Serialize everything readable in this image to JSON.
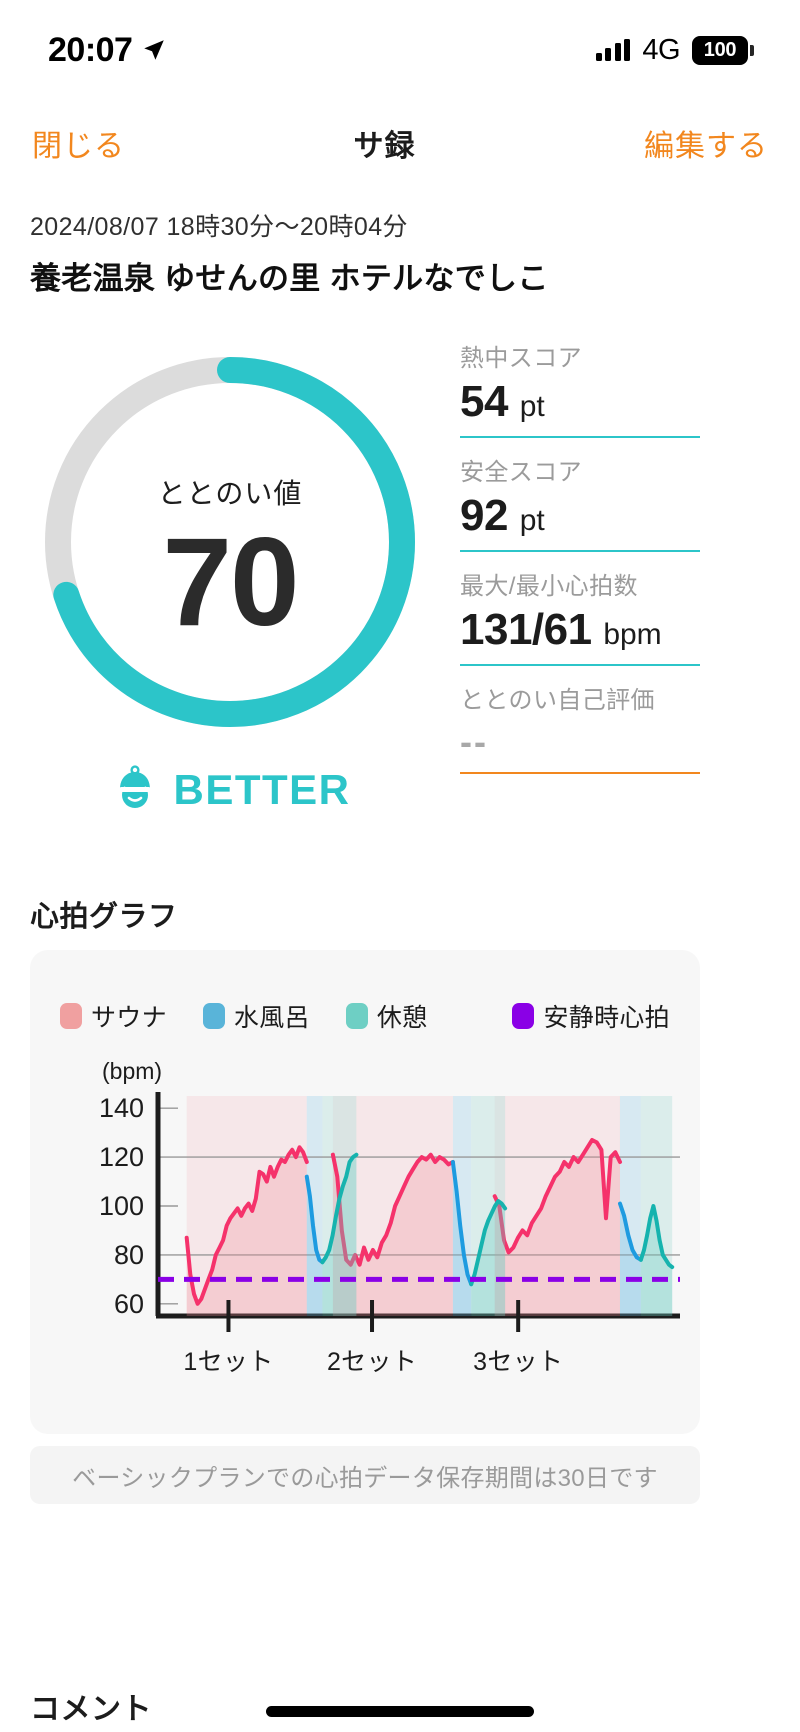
{
  "status_bar": {
    "time": "20:07",
    "location_icon": "location-arrow-icon",
    "signal_icon": "signal-bars-icon",
    "network": "4G",
    "battery_level": "100"
  },
  "nav_bar": {
    "close_label": "閉じる",
    "title": "サ録",
    "edit_label": "編集する"
  },
  "header": {
    "datetime": "2024/08/07 18時30分〜20時04分",
    "venue": "養老温泉 ゆせんの里 ホテルなでしこ"
  },
  "gauge": {
    "label": "ととのい値",
    "value": "70",
    "percent": 70,
    "verdict": "BETTER",
    "verdict_icon": "sauna-hat-face-icon",
    "track_color": "#DCDCDC",
    "arc_color": "#2CC5C9"
  },
  "stats": [
    {
      "label": "熱中スコア",
      "value": "54",
      "unit": "pt",
      "rule_color": "#2CC5C9"
    },
    {
      "label": "安全スコア",
      "value": "92",
      "unit": "pt",
      "rule_color": "#2CC5C9"
    },
    {
      "label": "最大/最小心拍数",
      "value": "131/61",
      "unit": "bpm",
      "rule_color": "#2CC5C9"
    },
    {
      "label": "ととのい自己評価",
      "value": "--",
      "unit": "",
      "rule_color": "#F2871E"
    }
  ],
  "chart_section": {
    "title": "心拍グラフ",
    "note": "ベーシックプランでの心拍データ保存期間は30日です"
  },
  "comment_section": {
    "title": "コメント"
  },
  "chart_data": {
    "type": "line",
    "title": "心拍グラフ",
    "xlabel": "",
    "ylabel": "(bpm)",
    "ylim": [
      55,
      145
    ],
    "yticks": [
      60,
      80,
      100,
      120,
      140
    ],
    "gridlines": [
      80,
      120
    ],
    "grid": true,
    "legend_position": "top",
    "legend": [
      {
        "name": "サウナ",
        "color": "#F0A0A0"
      },
      {
        "name": "水風呂",
        "color": "#59B4D9"
      },
      {
        "name": "休憩",
        "color": "#6ECFC4"
      },
      {
        "name": "安静時心拍",
        "color": "#8A00E6"
      }
    ],
    "xticks": [
      {
        "label": "1セット",
        "x": 0.135
      },
      {
        "label": "2セット",
        "x": 0.41
      },
      {
        "label": "3セット",
        "x": 0.69
      }
    ],
    "resting_hr": 70,
    "resting_hr_color": "#8A00E6",
    "line_colors": {
      "sauna": "#F5326B",
      "mizuburo": "#1E9BE0",
      "kyukei": "#16B3AE"
    },
    "fill_colors": {
      "sauna": "rgba(240,140,150,0.28)",
      "mizuburo": "rgba(110,190,225,0.30)",
      "kyukei": "rgba(110,207,196,0.35)"
    },
    "series": [
      {
        "name": "サウナ",
        "phase": "sauna",
        "segments": [
          {
            "x0": 0.055,
            "x1": 0.285,
            "values": [
              87,
              72,
              64,
              60,
              62,
              66,
              70,
              74,
              80,
              83,
              86,
              92,
              95,
              97,
              99,
              96,
              99,
              101,
              98,
              103,
              114,
              113,
              110,
              116,
              112,
              116,
              119,
              118,
              121,
              123,
              120,
              124,
              122,
              118
            ]
          },
          {
            "x0": 0.335,
            "x1": 0.565,
            "values": [
              121,
              112,
              90,
              78,
              76,
              80,
              76,
              83,
              78,
              82,
              79,
              85,
              88,
              93,
              100,
              104,
              108,
              112,
              115,
              118,
              120,
              119,
              121,
              118,
              120,
              119,
              117,
              118
            ]
          },
          {
            "x0": 0.645,
            "x1": 0.885,
            "values": [
              104,
              100,
              86,
              81,
              83,
              87,
              90,
              88,
              93,
              96,
              99,
              104,
              108,
              112,
              114,
              118,
              116,
              120,
              118,
              121,
              124,
              127,
              126,
              123,
              95,
              120,
              122,
              118
            ]
          }
        ]
      },
      {
        "name": "水風呂",
        "phase": "mizuburo",
        "segments": [
          {
            "x0": 0.285,
            "x1": 0.315,
            "values": [
              112,
              104,
              92,
              82,
              78,
              77
            ]
          },
          {
            "x0": 0.565,
            "x1": 0.6,
            "values": [
              118,
              106,
              92,
              80,
              72,
              68
            ]
          },
          {
            "x0": 0.885,
            "x1": 0.925,
            "values": [
              101,
              96,
              88,
              82,
              79,
              78
            ]
          }
        ]
      },
      {
        "name": "休憩",
        "phase": "kyukei",
        "segments": [
          {
            "x0": 0.315,
            "x1": 0.38,
            "values": [
              77,
              79,
              82,
              88,
              96,
              103,
              108,
              112,
              118,
              120,
              121
            ]
          },
          {
            "x0": 0.6,
            "x1": 0.665,
            "values": [
              68,
              72,
              78,
              84,
              90,
              94,
              97,
              100,
              102,
              101,
              99
            ]
          },
          {
            "x0": 0.925,
            "x1": 0.985,
            "values": [
              78,
              82,
              88,
              95,
              100,
              94,
              86,
              80,
              78,
              76,
              75
            ]
          }
        ]
      }
    ]
  }
}
